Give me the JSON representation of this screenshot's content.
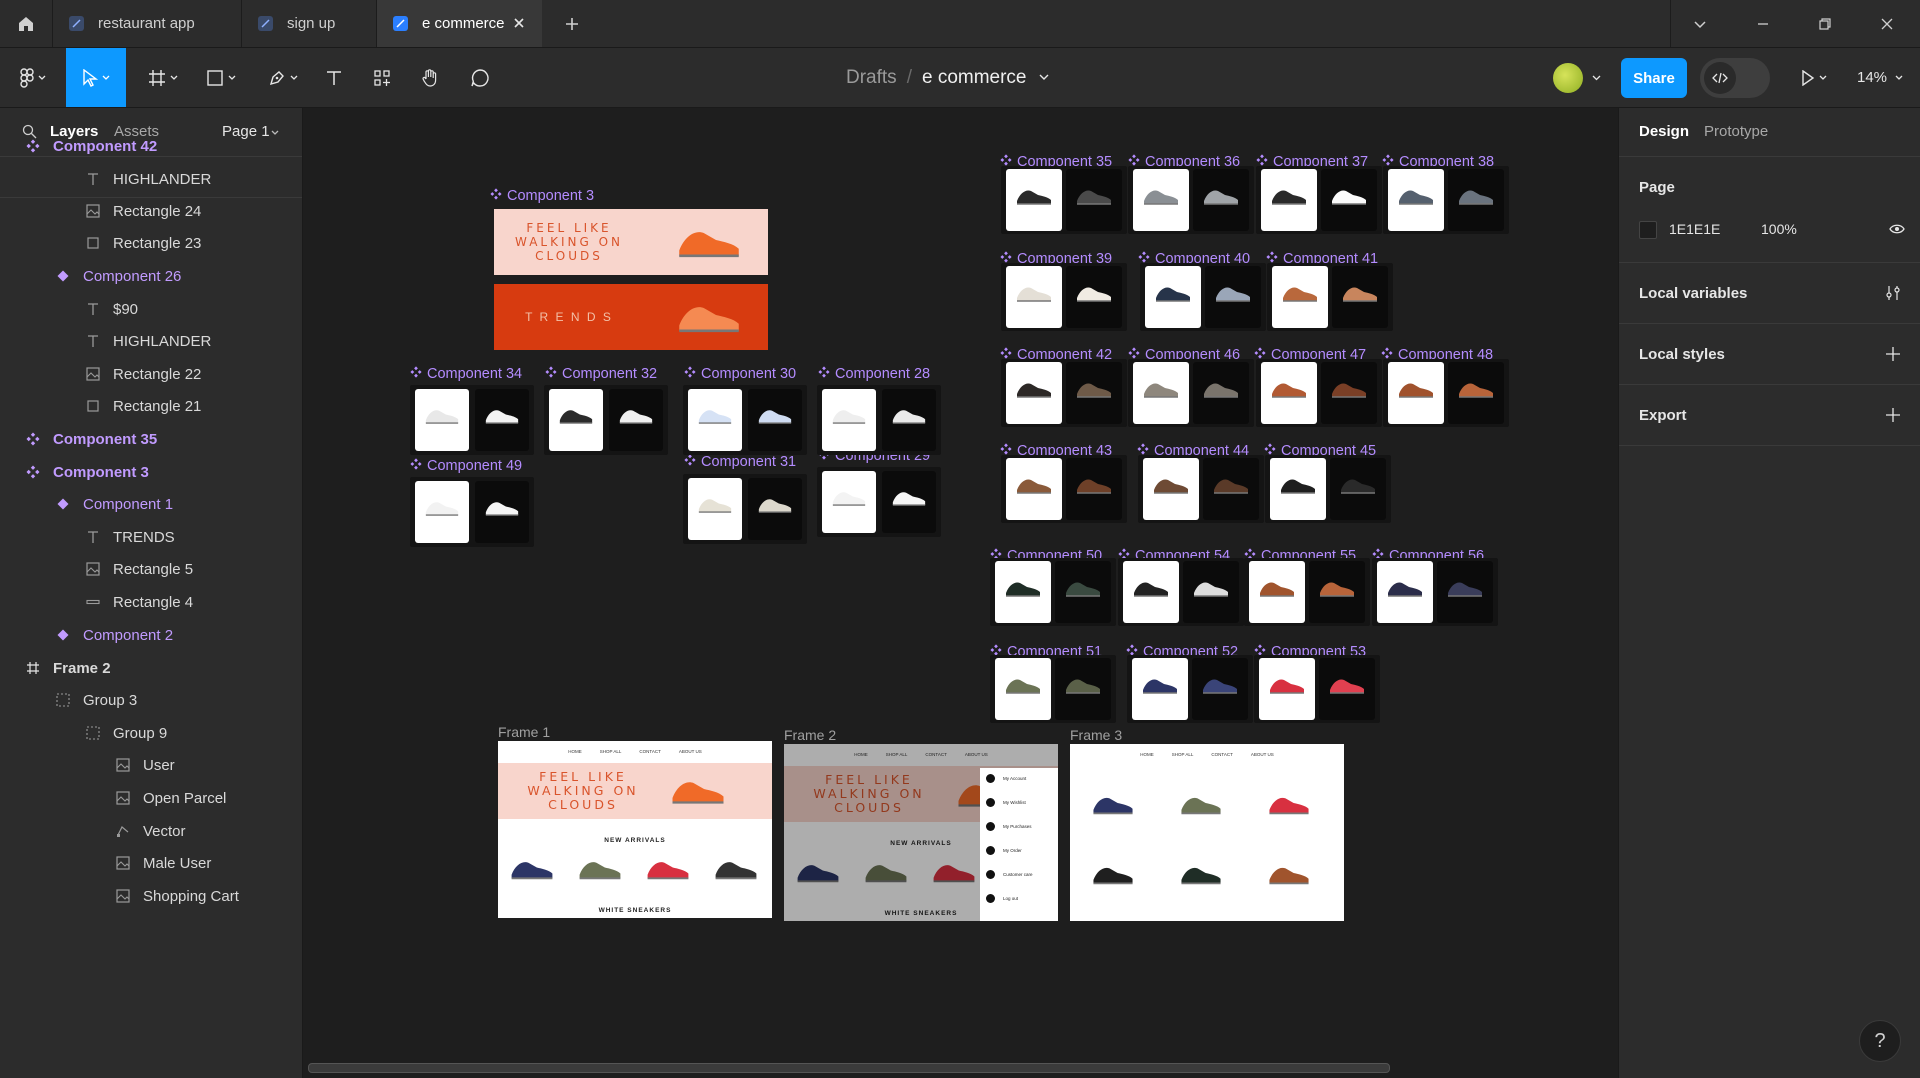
{
  "tabs": [
    {
      "label": "restaurant app",
      "active": false
    },
    {
      "label": "sign up",
      "active": false
    },
    {
      "label": "e commerce",
      "active": true
    }
  ],
  "breadcrumb": {
    "drafts": "Drafts",
    "separator": "/",
    "file": "e commerce"
  },
  "toolbar": {
    "share_label": "Share",
    "zoom": "14%"
  },
  "left_panel": {
    "tab_layers": "Layers",
    "tab_assets": "Assets",
    "page_select": "Page 1",
    "layers": [
      {
        "label": "Component 42",
        "type": "component-set",
        "indent": 0
      },
      {
        "label": "HIGHLANDER",
        "type": "text",
        "indent": 2
      },
      {
        "label": "Rectangle 24",
        "type": "image",
        "indent": 2
      },
      {
        "label": "Rectangle 23",
        "type": "rect",
        "indent": 2
      },
      {
        "label": "Component 26",
        "type": "component",
        "indent": 1
      },
      {
        "label": "$90",
        "type": "text",
        "indent": 2
      },
      {
        "label": "HIGHLANDER",
        "type": "text",
        "indent": 2
      },
      {
        "label": "Rectangle 22",
        "type": "image",
        "indent": 2
      },
      {
        "label": "Rectangle 21",
        "type": "rect",
        "indent": 2
      },
      {
        "label": "Component 35",
        "type": "component-set",
        "indent": 0
      },
      {
        "label": "Component 3",
        "type": "component-set",
        "indent": 0
      },
      {
        "label": "Component 1",
        "type": "component",
        "indent": 1
      },
      {
        "label": "TRENDS",
        "type": "text",
        "indent": 2
      },
      {
        "label": "Rectangle 5",
        "type": "image",
        "indent": 2
      },
      {
        "label": "Rectangle 4",
        "type": "line",
        "indent": 2
      },
      {
        "label": "Component 2",
        "type": "component",
        "indent": 1
      },
      {
        "label": "Frame 2",
        "type": "frame",
        "indent": 0
      },
      {
        "label": "Group 3",
        "type": "group",
        "indent": 1
      },
      {
        "label": "Group 9",
        "type": "group",
        "indent": 2
      },
      {
        "label": "User",
        "type": "image",
        "indent": 3
      },
      {
        "label": "Open Parcel",
        "type": "image",
        "indent": 3
      },
      {
        "label": "Vector",
        "type": "vector",
        "indent": 3
      },
      {
        "label": "Male User",
        "type": "image",
        "indent": 3
      },
      {
        "label": "Shopping Cart",
        "type": "image",
        "indent": 3
      }
    ]
  },
  "right_panel": {
    "tab_design": "Design",
    "tab_prototype": "Prototype",
    "page_title": "Page",
    "page_color": "1E1E1E",
    "page_opacity": "100%",
    "local_variables": "Local variables",
    "local_styles": "Local styles",
    "export": "Export"
  },
  "help_label": "?",
  "canvas": {
    "component_labels": [
      "Component 3",
      "Component 34",
      "Component 32",
      "Component 30",
      "Component 28",
      "Component 49",
      "Component 31",
      "Component 29",
      "Component 35",
      "Component 36",
      "Component 37",
      "Component 38",
      "Component 39",
      "Component 40",
      "Component 41",
      "Component 42",
      "Component 46",
      "Component 47",
      "Component 48",
      "Component 43",
      "Component 44",
      "Component 45",
      "Component 50",
      "Component 54",
      "Component 55",
      "Component 56",
      "Component 51",
      "Component 52",
      "Component 53"
    ],
    "frame_labels": [
      "Frame 1",
      "Frame 2",
      "Frame 3"
    ],
    "banner_text": "FEEL LIKE WALKING ON CLOUDS",
    "banner_trends": "T R E N D S",
    "new_arrivals": "NEW ARRIVALS",
    "white_sneakers": "WHITE SNEAKERS",
    "nav_items": [
      "HOME",
      "SHOP ALL",
      "CONTACT",
      "ABOUT US"
    ],
    "menu_items": [
      "My Account",
      "My Wishlist",
      "My Purchases",
      "My Order",
      "Customer care",
      "Log out"
    ]
  },
  "colors": {
    "accent": "#0d99ff",
    "component": "#c19bff",
    "banner_pink": "#f8d5cc",
    "banner_orange": "#d73b10",
    "shoe_orange": "#f06a28"
  }
}
